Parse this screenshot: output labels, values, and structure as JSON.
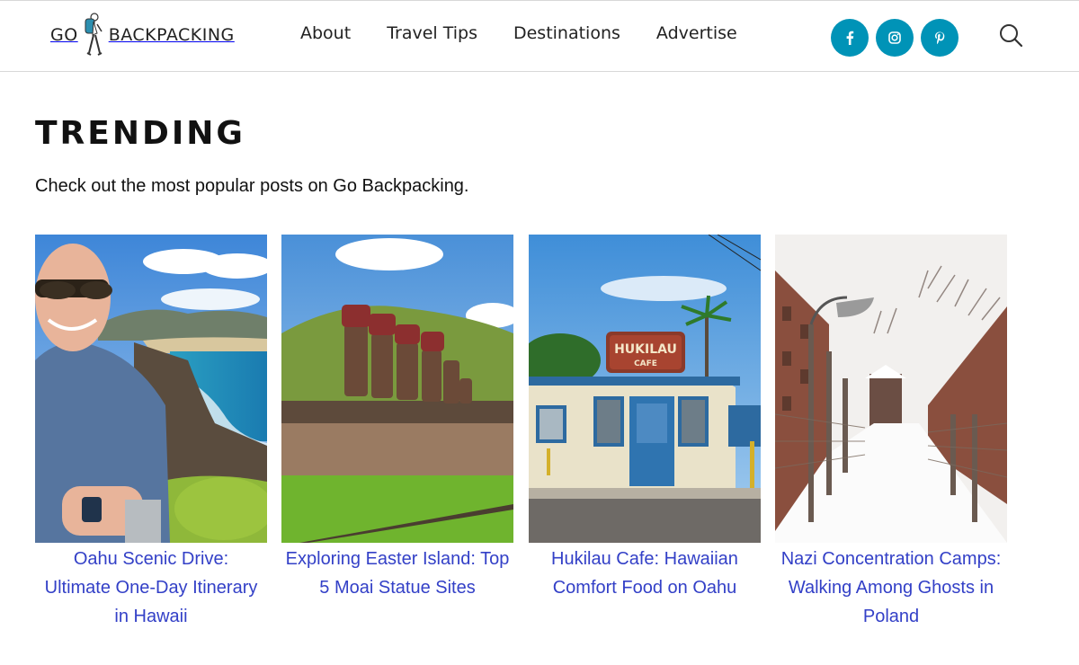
{
  "header": {
    "logo_go": "GO",
    "logo_rest": "BACKPACKING",
    "nav": [
      "About",
      "Travel Tips",
      "Destinations",
      "Advertise"
    ],
    "social": [
      {
        "name": "facebook-icon"
      },
      {
        "name": "instagram-icon"
      },
      {
        "name": "pinterest-icon"
      }
    ],
    "accent_color": "#0093b7"
  },
  "main": {
    "title": "TRENDING",
    "intro": "Check out the most popular posts on Go Backpacking.",
    "link_color": "#3340c7",
    "cards": [
      {
        "caption": "Oahu Scenic Drive: Ultimate One-Day Itinerary in Hawaii",
        "image": "man-on-oahu-coast-photo"
      },
      {
        "caption": "Exploring Easter Island: Top 5 Moai Statue Sites",
        "image": "moai-statues-photo"
      },
      {
        "caption": "Hukilau Cafe: Hawaiian Comfort Food on Oahu",
        "image": "hukilau-cafe-photo"
      },
      {
        "caption": "Nazi Concentration Camps: Walking Among Ghosts in Poland",
        "image": "snowy-camp-fence-photo"
      }
    ],
    "hukilau_sign": {
      "line1": "HUKILAU",
      "line2": "CAFE"
    }
  }
}
